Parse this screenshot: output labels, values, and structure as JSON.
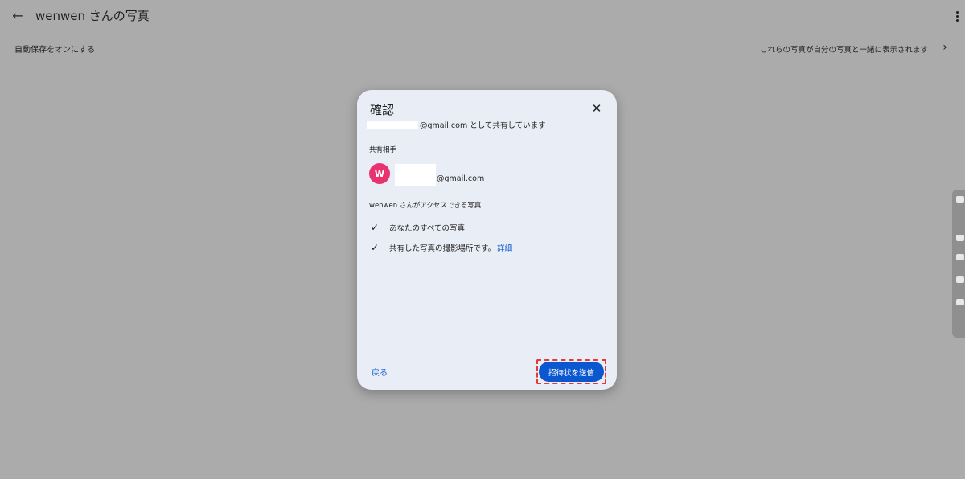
{
  "header": {
    "title": "wenwen さんの写真",
    "back_icon": "←",
    "more_icon": "more-vert-icon"
  },
  "toolbar": {
    "autosave_label": "自動保存をオンにする",
    "shown_with_text": "これらの写真が自分の写真と一緒に表示されます",
    "chevron_icon": "›"
  },
  "dialog": {
    "title": "確認",
    "close_icon": "✕",
    "sharing_as_suffix": "@gmail.com として共有しています",
    "shared_with_label": "共有相手",
    "recipient": {
      "avatar_letter": "W",
      "email_suffix": "@gmail.com",
      "avatar_color": "#e8336f"
    },
    "access_label": "wenwen さんがアクセスできる写真",
    "permissions": [
      {
        "text": "あなたのすべての写真"
      },
      {
        "text": "共有した写真の撮影場所です。",
        "link": "詳細"
      }
    ],
    "check_icon": "✓",
    "back_button": "戻る",
    "send_button": "招待状を送信"
  },
  "colors": {
    "accent": "#0b57d0",
    "overlay_bg": "#ababab",
    "dialog_bg": "#e9edf6",
    "highlight": "#e53935"
  }
}
